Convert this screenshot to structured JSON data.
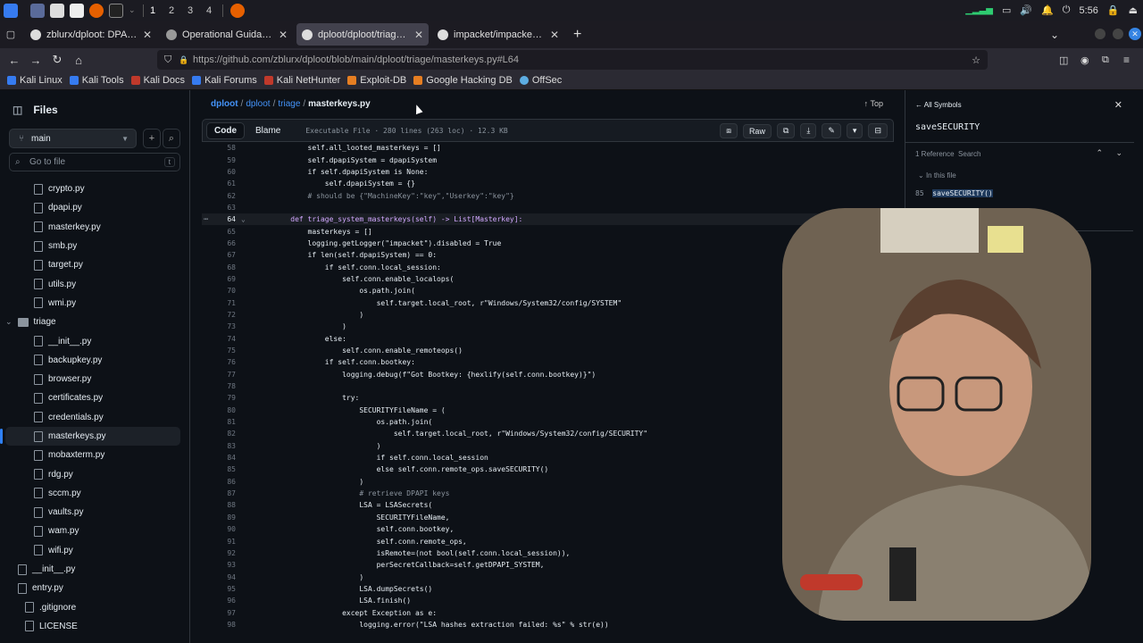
{
  "taskbar": {
    "workspaces": [
      "1",
      "2",
      "3",
      "4"
    ],
    "clock": "5:56"
  },
  "tabs": [
    {
      "title": "zblurx/dploot: DPAPI loot",
      "active": false
    },
    {
      "title": "Operational Guidance for",
      "active": false
    },
    {
      "title": "dploot/dploot/triage/ma",
      "active": true
    },
    {
      "title": "impacket/impacket/exam",
      "active": false
    }
  ],
  "nav": {
    "url": "https://github.com/zblurx/dploot/blob/main/dploot/triage/masterkeys.py#L64"
  },
  "bookmarks": [
    "Kali Linux",
    "Kali Tools",
    "Kali Docs",
    "Kali Forums",
    "Kali NetHunter",
    "Exploit-DB",
    "Google Hacking DB",
    "OffSec"
  ],
  "sidebar": {
    "title": "Files",
    "branch": "main",
    "search_placeholder": "Go to file",
    "search_key": "t",
    "files": [
      {
        "name": "crypto.py",
        "type": "file",
        "indent": 1
      },
      {
        "name": "dpapi.py",
        "type": "file",
        "indent": 1
      },
      {
        "name": "masterkey.py",
        "type": "file",
        "indent": 1
      },
      {
        "name": "smb.py",
        "type": "file",
        "indent": 1
      },
      {
        "name": "target.py",
        "type": "file",
        "indent": 1
      },
      {
        "name": "utils.py",
        "type": "file",
        "indent": 1
      },
      {
        "name": "wmi.py",
        "type": "file",
        "indent": 1
      },
      {
        "name": "triage",
        "type": "dir",
        "indent": 0
      },
      {
        "name": "__init__.py",
        "type": "file",
        "indent": 1
      },
      {
        "name": "backupkey.py",
        "type": "file",
        "indent": 1
      },
      {
        "name": "browser.py",
        "type": "file",
        "indent": 1
      },
      {
        "name": "certificates.py",
        "type": "file",
        "indent": 1
      },
      {
        "name": "credentials.py",
        "type": "file",
        "indent": 1
      },
      {
        "name": "masterkeys.py",
        "type": "file",
        "indent": 1,
        "selected": true
      },
      {
        "name": "mobaxterm.py",
        "type": "file",
        "indent": 1
      },
      {
        "name": "rdg.py",
        "type": "file",
        "indent": 1
      },
      {
        "name": "sccm.py",
        "type": "file",
        "indent": 1
      },
      {
        "name": "vaults.py",
        "type": "file",
        "indent": 1
      },
      {
        "name": "wam.py",
        "type": "file",
        "indent": 1
      },
      {
        "name": "wifi.py",
        "type": "file",
        "indent": 1
      },
      {
        "name": "__init__.py",
        "type": "file",
        "indent": 0
      },
      {
        "name": "entry.py",
        "type": "file",
        "indent": 0
      },
      {
        "name": ".gitignore",
        "type": "file",
        "indent": -1
      },
      {
        "name": "LICENSE",
        "type": "file",
        "indent": -1
      }
    ]
  },
  "breadcrumb": {
    "repo": "dploot",
    "dir1": "dploot",
    "dir2": "triage",
    "file": "masterkeys.py",
    "top": "Top"
  },
  "codebar": {
    "code": "Code",
    "blame": "Blame",
    "info": "Executable File · 280 lines (263 loc) · 12.3 KB",
    "raw": "Raw"
  },
  "code_lines": [
    {
      "n": "58",
      "t": "        self.all_looted_masterkeys = []"
    },
    {
      "n": "59",
      "t": "        self.dpapiSystem = dpapiSystem"
    },
    {
      "n": "60",
      "t": "        if self.dpapiSystem is None:"
    },
    {
      "n": "61",
      "t": "            self.dpapiSystem = {}"
    },
    {
      "n": "62",
      "t": "        # should be {\"MachineKey\":\"key\",\"Userkey\":\"key\"}"
    },
    {
      "n": "63",
      "t": ""
    },
    {
      "n": "64",
      "t": "    def triage_system_masterkeys(self) -> List[Masterkey]:"
    },
    {
      "n": "65",
      "t": "        masterkeys = []"
    },
    {
      "n": "66",
      "t": "        logging.getLogger(\"impacket\").disabled = True"
    },
    {
      "n": "67",
      "t": "        if len(self.dpapiSystem) == 0:"
    },
    {
      "n": "68",
      "t": "            if self.conn.local_session:"
    },
    {
      "n": "69",
      "t": "                self.conn.enable_localops("
    },
    {
      "n": "70",
      "t": "                    os.path.join("
    },
    {
      "n": "71",
      "t": "                        self.target.local_root, r\"Windows/System32/config/SYSTEM\""
    },
    {
      "n": "72",
      "t": "                    )"
    },
    {
      "n": "73",
      "t": "                )"
    },
    {
      "n": "74",
      "t": "            else:"
    },
    {
      "n": "75",
      "t": "                self.conn.enable_remoteops()"
    },
    {
      "n": "76",
      "t": "            if self.conn.bootkey:"
    },
    {
      "n": "77",
      "t": "                logging.debug(f\"Got Bootkey: {hexlify(self.conn.bootkey)}\")"
    },
    {
      "n": "78",
      "t": ""
    },
    {
      "n": "79",
      "t": "                try:"
    },
    {
      "n": "80",
      "t": "                    SECURITYFileName = ("
    },
    {
      "n": "81",
      "t": "                        os.path.join("
    },
    {
      "n": "82",
      "t": "                            self.target.local_root, r\"Windows/System32/config/SECURITY\""
    },
    {
      "n": "83",
      "t": "                        )"
    },
    {
      "n": "84",
      "t": "                        if self.conn.local_session"
    },
    {
      "n": "85",
      "t": "                        else self.conn.remote_ops.saveSECURITY()"
    },
    {
      "n": "86",
      "t": "                    )"
    },
    {
      "n": "87",
      "t": "                    # retrieve DPAPI keys"
    },
    {
      "n": "88",
      "t": "                    LSA = LSASecrets("
    },
    {
      "n": "89",
      "t": "                        SECURITYFileName,"
    },
    {
      "n": "90",
      "t": "                        self.conn.bootkey,"
    },
    {
      "n": "91",
      "t": "                        self.conn.remote_ops,"
    },
    {
      "n": "92",
      "t": "                        isRemote=(not bool(self.conn.local_session)),"
    },
    {
      "n": "93",
      "t": "                        perSecretCallback=self.getDPAPI_SYSTEM,"
    },
    {
      "n": "94",
      "t": "                    )"
    },
    {
      "n": "95",
      "t": "                    LSA.dumpSecrets()"
    },
    {
      "n": "96",
      "t": "                    LSA.finish()"
    },
    {
      "n": "97",
      "t": "                except Exception as e:"
    },
    {
      "n": "98",
      "t": "                    logging.error(\"LSA hashes extraction failed: %s\" % str(e))"
    }
  ],
  "symbols": {
    "back": "All Symbols",
    "name": "saveSECURITY",
    "refs": "1 Reference",
    "search": "Search",
    "in_file": "In this file",
    "ref_line": "85",
    "ref_text": "saveSECURITY()"
  },
  "colors": {
    "accent": "#2f81f7",
    "link": "#4493f8",
    "keyword": "#ff7b72",
    "string": "#a5d6ff",
    "func": "#d2a8ff",
    "comment": "#8b949e"
  }
}
